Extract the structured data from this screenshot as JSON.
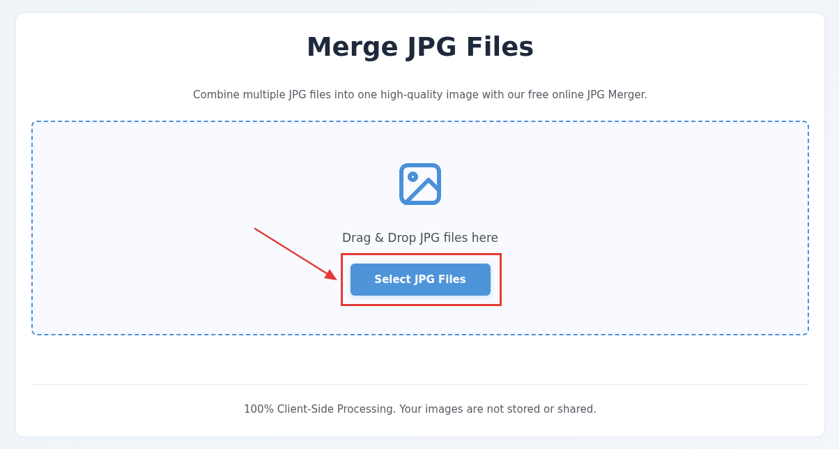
{
  "title": "Merge JPG Files",
  "subtitle": "Combine multiple JPG files into one high-quality image with our free online JPG Merger.",
  "dropzone": {
    "prompt": "Drag & Drop JPG files here",
    "button": {
      "label": "Select JPG Files",
      "highlighted": true
    }
  },
  "footer": "100% Client-Side Processing. Your images are not stored or shared."
}
